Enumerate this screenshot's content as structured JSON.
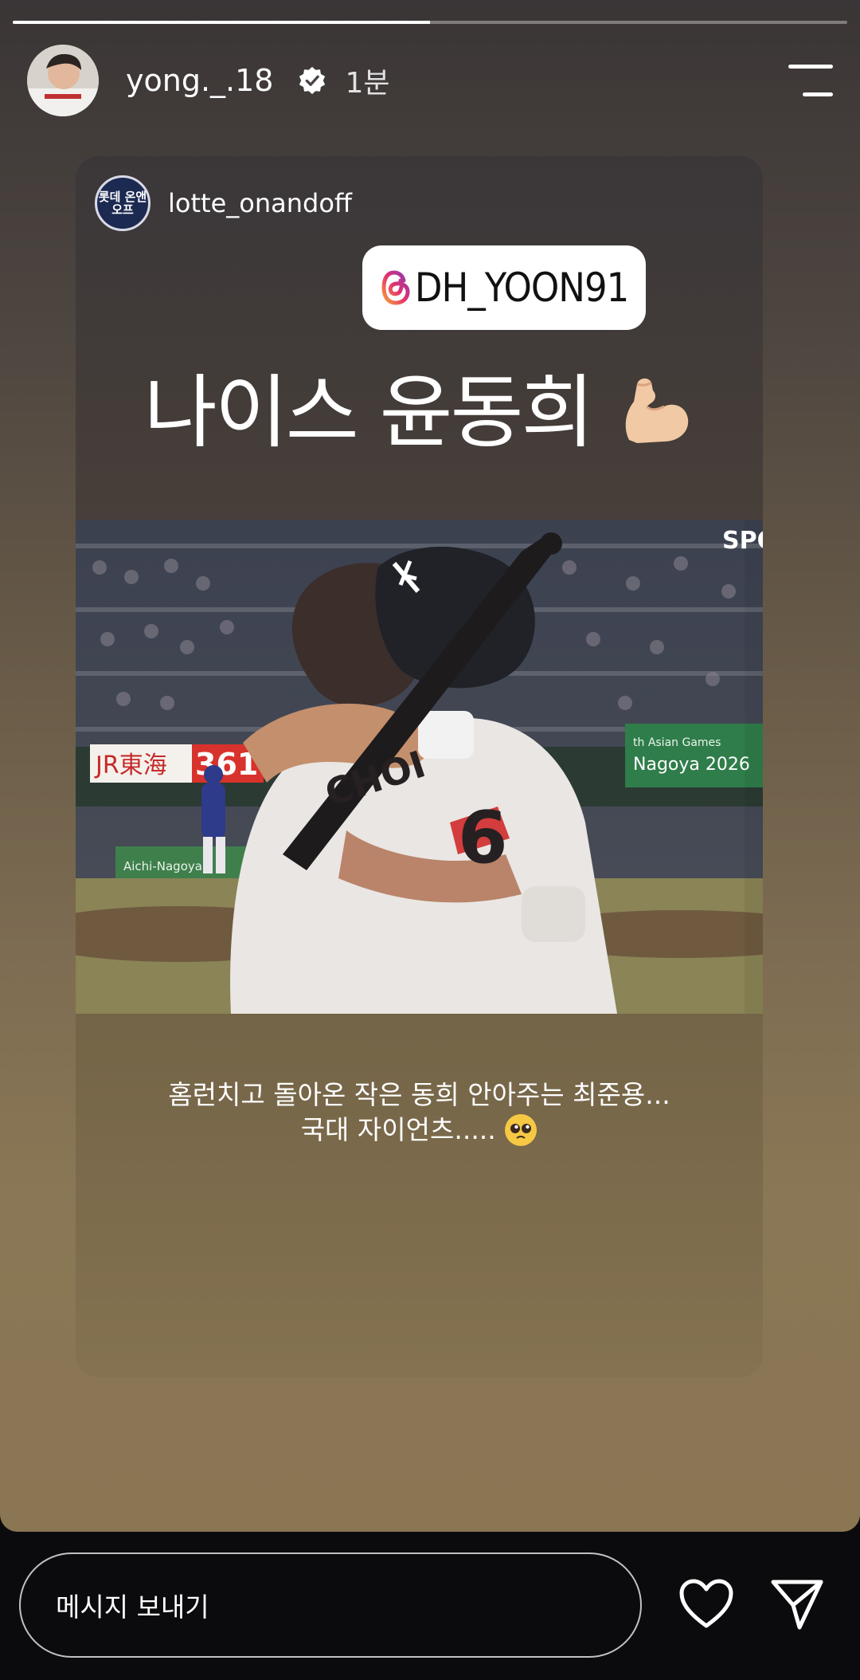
{
  "progress": {
    "fraction": 0.5
  },
  "header": {
    "username": "yong._.18",
    "time": "1분"
  },
  "card": {
    "username": "lotte_onandoff",
    "avatar_text": "롯데 온앤오프",
    "mention": "DH_YOON91",
    "headline": "나이스 윤동희",
    "caption_line1": "홈런치고 돌아온 작은 동희 안아주는 최준용...",
    "caption_line2": "국대 자이언츠.....",
    "photo": {
      "sign_jr": "JR東海",
      "sign_361": "361°",
      "sign_games": "th Asian Games",
      "sign_nagoya": "Nagoya 2026",
      "sign_aichi": "Aichi-Nagoya",
      "watermark": "SPO",
      "jersey_text": "CHOI",
      "jersey_number": "6"
    }
  },
  "footer": {
    "message_placeholder": "메시지 보내기"
  },
  "icons": {
    "verified": "verified-badge-icon",
    "menu": "menu-icon",
    "heart": "heart-icon",
    "send": "send-icon",
    "mention": "threads-icon"
  },
  "colors": {
    "accent_blue": "#1c2a52",
    "story_bottom": "#8a7653"
  }
}
